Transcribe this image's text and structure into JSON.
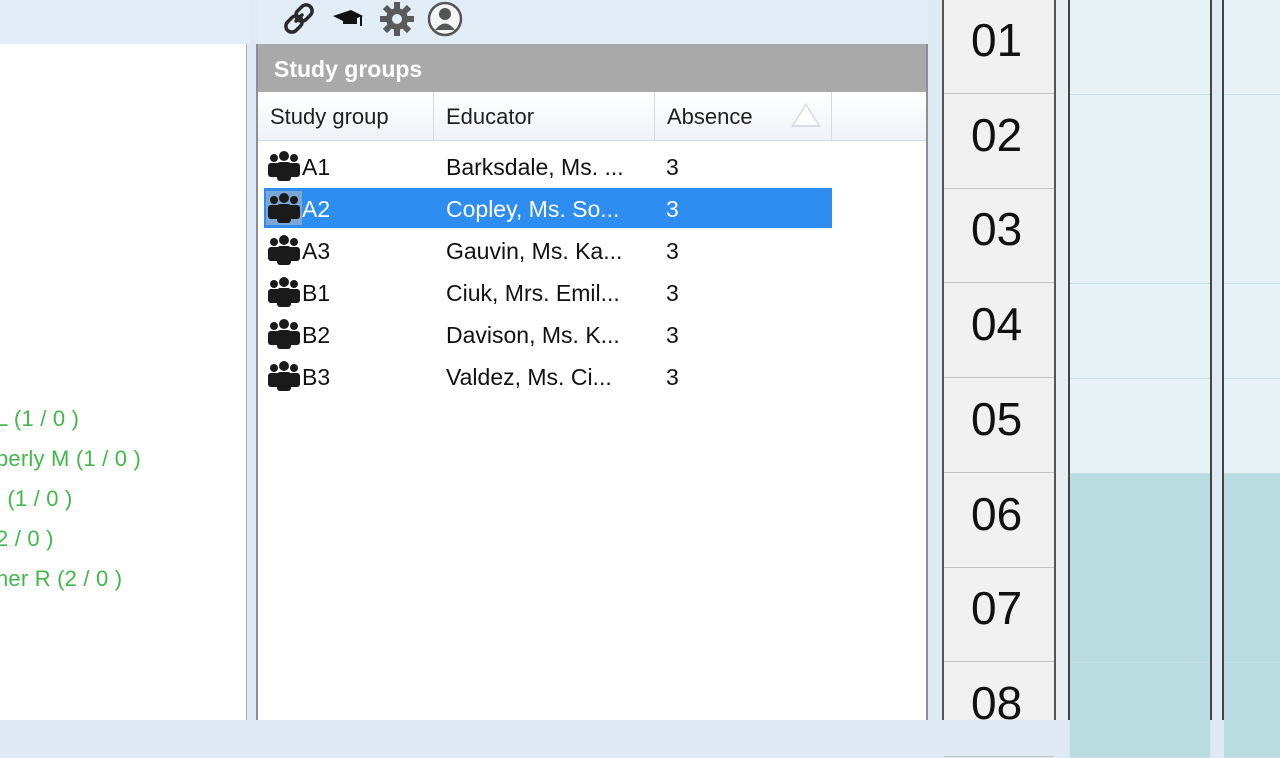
{
  "toolbar": {
    "icons": [
      "link-icon",
      "graduation-cap-icon",
      "gear-icon",
      "user-icon"
    ]
  },
  "left_panel": {
    "items": [
      "L (1 / 0 )",
      "berly M (1 / 0 )",
      "l (1 / 0 )",
      "2 / 0 )",
      "ner R (2 / 0 )"
    ]
  },
  "study_groups": {
    "title": "Study groups",
    "columns": [
      "Study group",
      "Educator",
      "Absence"
    ],
    "sort_column": "Absence",
    "rows": [
      {
        "group": "A1",
        "educator": "Barksdale, Ms. ...",
        "absence": "3",
        "selected": false
      },
      {
        "group": "A2",
        "educator": "Copley, Ms. So...",
        "absence": "3",
        "selected": true
      },
      {
        "group": "A3",
        "educator": "Gauvin, Ms. Ka...",
        "absence": "3",
        "selected": false
      },
      {
        "group": "B1",
        "educator": "Ciuk, Mrs. Emil...",
        "absence": "3",
        "selected": false
      },
      {
        "group": "B2",
        "educator": "Davison, Ms. K...",
        "absence": "3",
        "selected": false
      },
      {
        "group": "B3",
        "educator": "Valdez, Ms. Ci...",
        "absence": "3",
        "selected": false
      }
    ]
  },
  "timetable": {
    "periods": [
      "01",
      "02",
      "03",
      "04",
      "05",
      "06",
      "07",
      "08"
    ],
    "light_color": "#e6f2f3",
    "dark_color": "#b8dcdf"
  },
  "colors": {
    "selection": "#2e8df0",
    "left_item_text": "#42b84a",
    "title_bar": "#a9a9a9"
  }
}
